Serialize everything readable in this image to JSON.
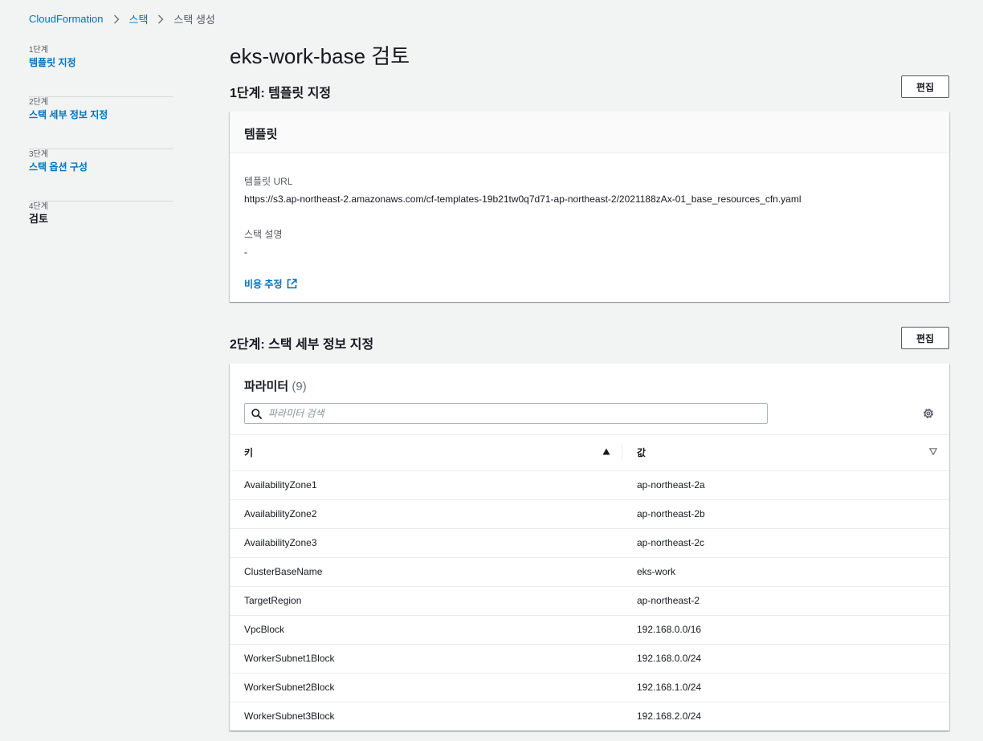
{
  "breadcrumb": {
    "root": "CloudFormation",
    "stacks": "스택",
    "current": "스택 생성"
  },
  "steps": [
    {
      "num": "1단계",
      "label": "템플릿 지정"
    },
    {
      "num": "2단계",
      "label": "스택 세부 정보 지정"
    },
    {
      "num": "3단계",
      "label": "스택 옵션 구성"
    },
    {
      "num": "4단계",
      "label": "검토"
    }
  ],
  "page_title": "eks-work-base 검토",
  "section1": {
    "title": "1단계: 템플릿 지정",
    "edit_label": "편집",
    "card_header": "템플릿",
    "template_url_label": "템플릿 URL",
    "template_url": "https://s3.ap-northeast-2.amazonaws.com/cf-templates-19b21tw0q7d71-ap-northeast-2/2021188zAx-01_base_resources_cfn.yaml",
    "description_label": "스택 설명",
    "description": "-",
    "cost_link": "비용 추정"
  },
  "section2": {
    "title": "2단계: 스택 세부 정보 지정",
    "edit_label": "편집",
    "params_title": "파라미터",
    "params_count": "(9)",
    "search_placeholder": "파라미터 검색",
    "col_key": "키",
    "col_value": "값",
    "rows": [
      {
        "key": "AvailabilityZone1",
        "value": "ap-northeast-2a"
      },
      {
        "key": "AvailabilityZone2",
        "value": "ap-northeast-2b"
      },
      {
        "key": "AvailabilityZone3",
        "value": "ap-northeast-2c"
      },
      {
        "key": "ClusterBaseName",
        "value": "eks-work"
      },
      {
        "key": "TargetRegion",
        "value": "ap-northeast-2"
      },
      {
        "key": "VpcBlock",
        "value": "192.168.0.0/16"
      },
      {
        "key": "WorkerSubnet1Block",
        "value": "192.168.0.0/24"
      },
      {
        "key": "WorkerSubnet2Block",
        "value": "192.168.1.0/24"
      },
      {
        "key": "WorkerSubnet3Block",
        "value": "192.168.2.0/24"
      }
    ]
  }
}
